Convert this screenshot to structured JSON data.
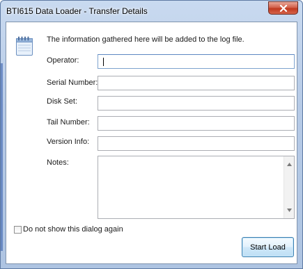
{
  "window": {
    "title": "BTI615 Data Loader - Transfer Details",
    "close_glyph": "x"
  },
  "info_text": "The information gathered here will be added to the log file.",
  "fields": [
    {
      "label": "Operator:",
      "value": ""
    },
    {
      "label": "Serial Number:",
      "value": ""
    },
    {
      "label": "Disk Set:",
      "value": ""
    },
    {
      "label": "Tail Number:",
      "value": ""
    },
    {
      "label": "Version Info:",
      "value": ""
    }
  ],
  "notes": {
    "label": "Notes:",
    "value": ""
  },
  "checkbox": {
    "label": "Do not show this dialog again",
    "checked": false
  },
  "buttons": {
    "start_load": "Start Load"
  },
  "icons": {
    "dialog": "notepad-icon",
    "close": "close-icon",
    "scroll_up": "scroll-up-arrow-icon",
    "scroll_down": "scroll-down-arrow-icon"
  },
  "colors": {
    "title_bar": "#b6cae6",
    "close_button": "#c0391f",
    "default_button_border": "#3c7fb1",
    "focused_field_border": "#7da2ce"
  }
}
